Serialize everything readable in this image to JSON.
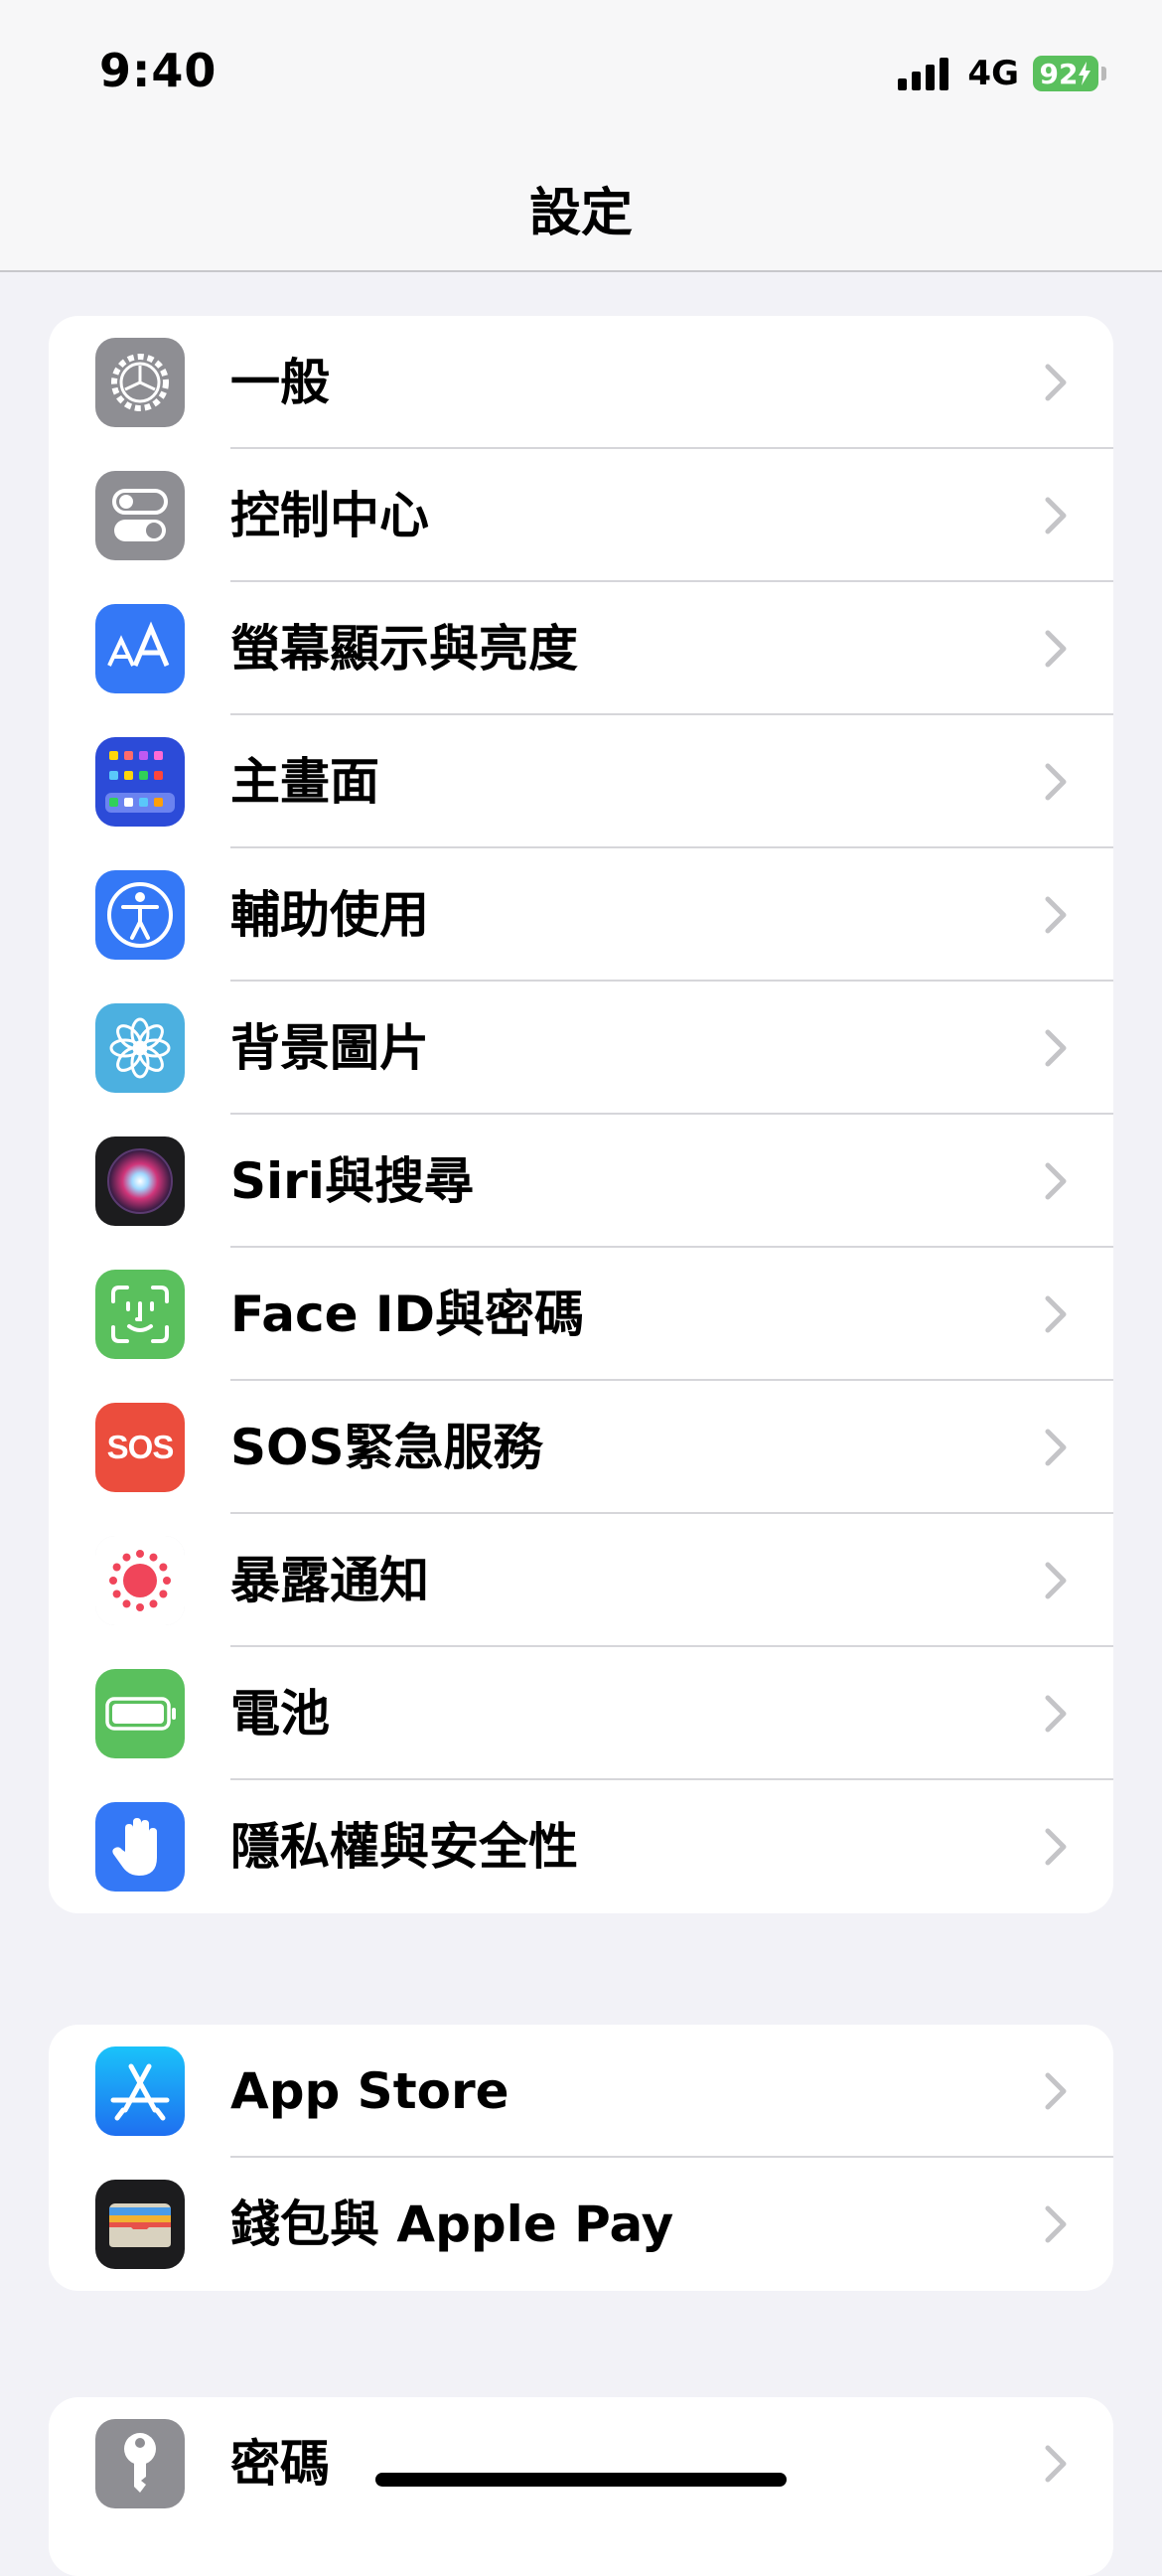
{
  "status_bar": {
    "time": "9:40",
    "network": "4G",
    "battery": "92"
  },
  "nav": {
    "title": "設定"
  },
  "groups": [
    {
      "items": [
        {
          "label": "一般",
          "icon": "gear-icon",
          "color": "#8e8e93"
        },
        {
          "label": "控制中心",
          "icon": "toggles-icon",
          "color": "#8e8e93"
        },
        {
          "label": "螢幕顯示與亮度",
          "icon": "text-size-icon",
          "color": "#3478f6"
        },
        {
          "label": "主畫面",
          "icon": "home-screen-icon",
          "color": "#2c4bd8"
        },
        {
          "label": "輔助使用",
          "icon": "accessibility-icon",
          "color": "#3478f6"
        },
        {
          "label": "背景圖片",
          "icon": "flower-icon",
          "color": "#4cb0e0"
        },
        {
          "label": "Siri與搜尋",
          "icon": "siri-icon",
          "color": "#1c1c1e"
        },
        {
          "label": "Face ID與密碼",
          "icon": "face-id-icon",
          "color": "#5ac05d"
        },
        {
          "label": "SOS緊急服務",
          "icon": "sos-icon",
          "color": "#eb4d3d"
        },
        {
          "label": "暴露通知",
          "icon": "exposure-icon",
          "color": "#ffffff"
        },
        {
          "label": "電池",
          "icon": "battery-icon",
          "color": "#5ac05d"
        },
        {
          "label": "隱私權與安全性",
          "icon": "hand-icon",
          "color": "#3478f6"
        }
      ]
    },
    {
      "items": [
        {
          "label": "App Store",
          "icon": "app-store-icon",
          "color": "#2f8ef5"
        },
        {
          "label": "錢包與 Apple Pay",
          "icon": "wallet-icon",
          "color": "#1c1c1e"
        }
      ]
    },
    {
      "items": [
        {
          "label": "密碼",
          "icon": "key-icon",
          "color": "#8e8e93"
        }
      ]
    }
  ]
}
